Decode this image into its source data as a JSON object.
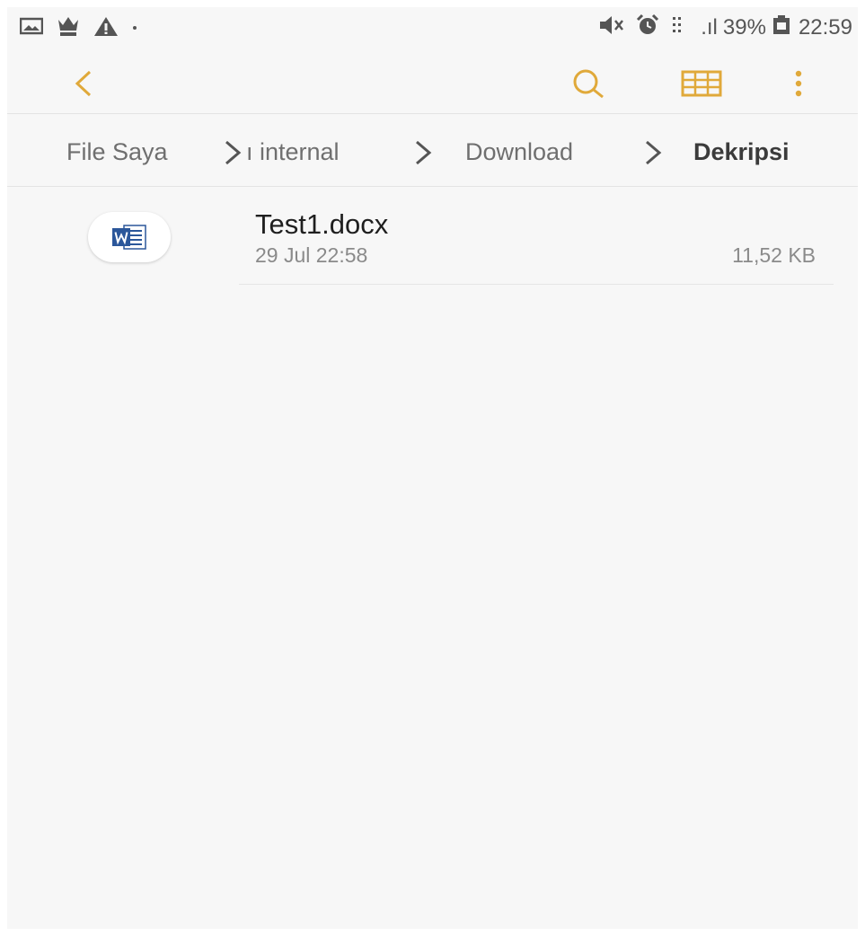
{
  "status_bar": {
    "signal_text": ".ıl",
    "battery": "39%",
    "time": "22:59"
  },
  "toolbar": {
    "accent_color": "#e0a93a"
  },
  "breadcrumb": {
    "items": [
      {
        "label": "File Saya"
      },
      {
        "label": "ı internal"
      },
      {
        "label": "Download"
      },
      {
        "label": "Dekripsi"
      }
    ]
  },
  "files": [
    {
      "name": "Test1.docx",
      "date": "29 Jul 22:58",
      "size": "11,52 KB",
      "type_icon": "word-doc-icon",
      "icon_color": "#2b579a"
    }
  ]
}
